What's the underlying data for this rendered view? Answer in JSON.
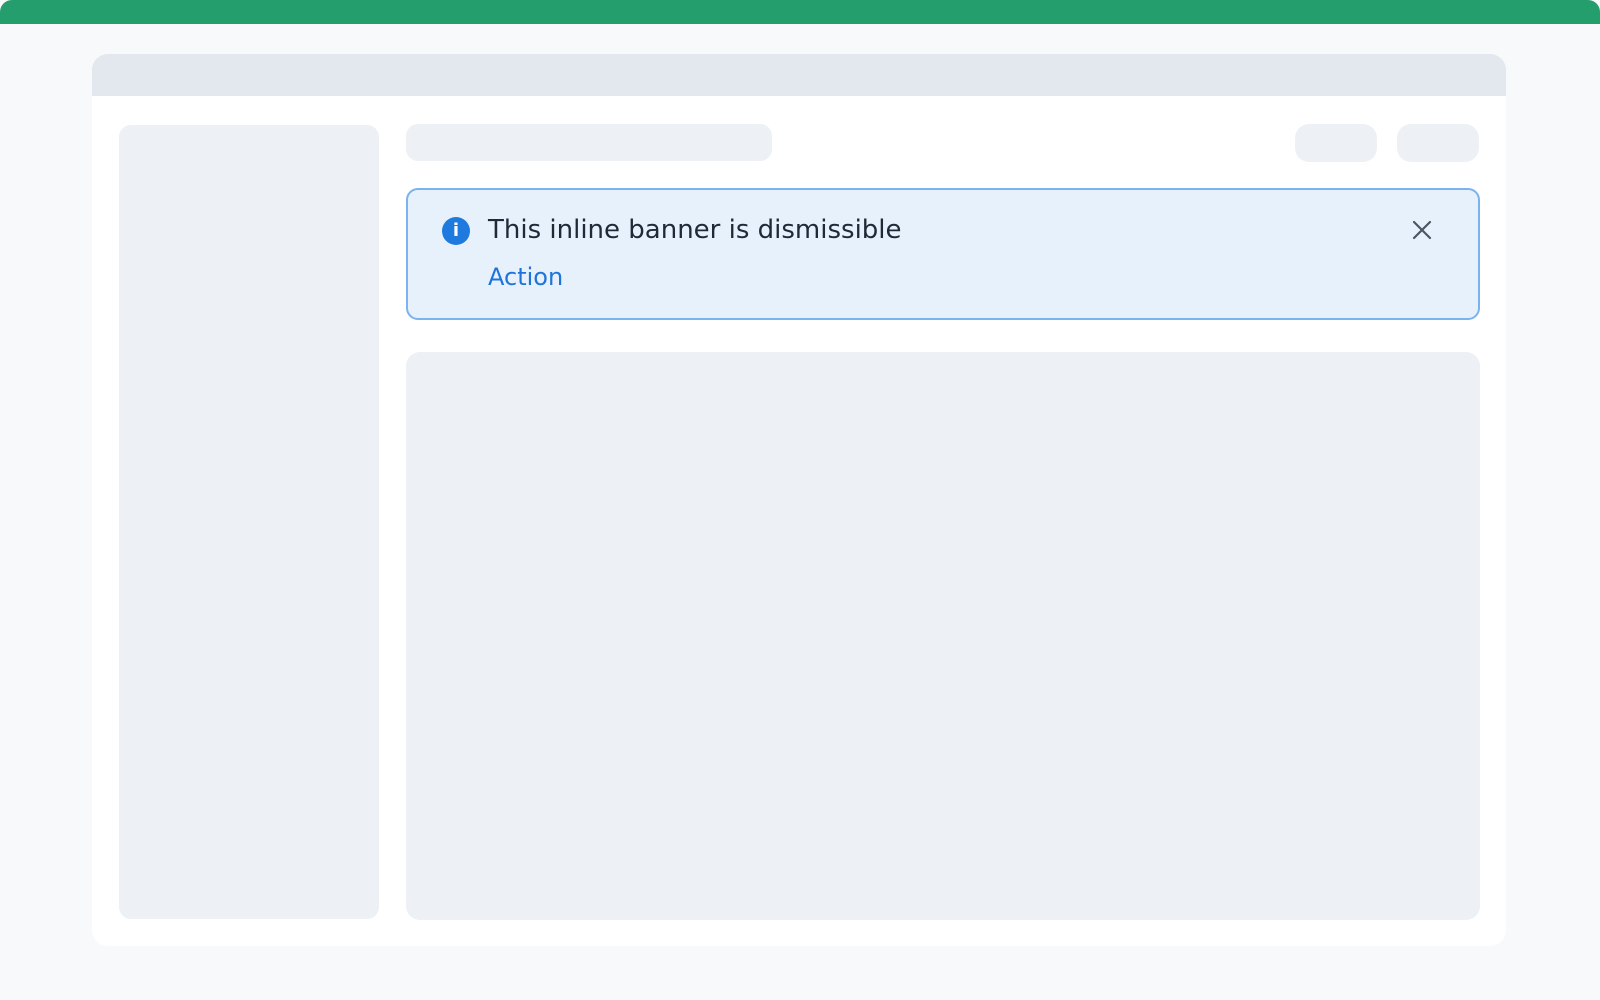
{
  "banner": {
    "title": "This inline banner is dismissible",
    "action_label": "Action",
    "icon": "info-icon",
    "close_icon": "close-icon"
  },
  "colors": {
    "accent": "#259e6d",
    "banner_bg": "#e7f1fb",
    "banner_border": "#7ab3ee",
    "info": "#1f7ae0",
    "link": "#1f74d9"
  }
}
